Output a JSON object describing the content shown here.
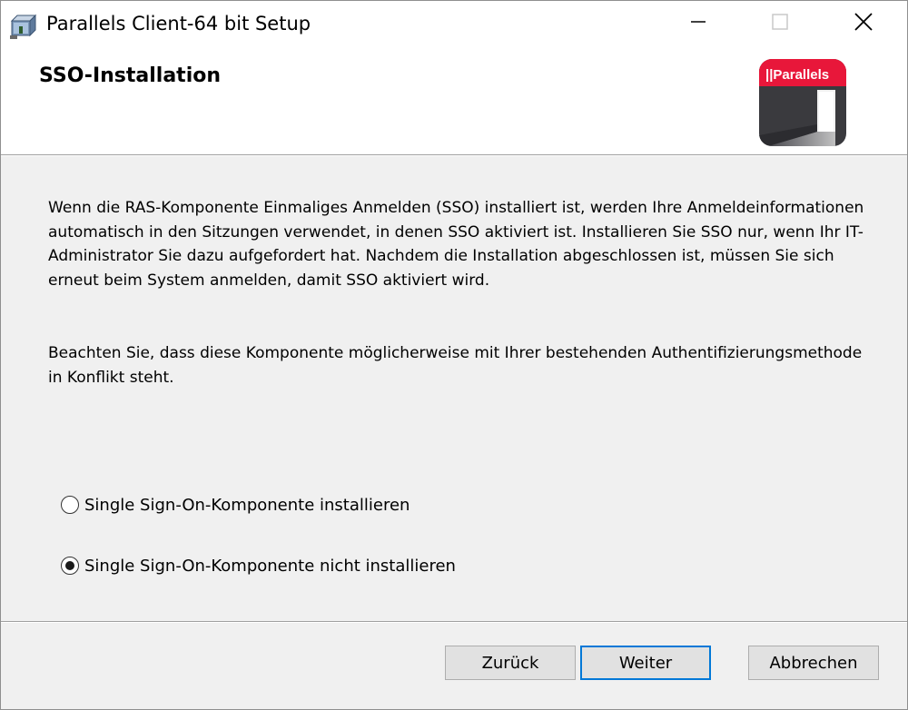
{
  "window": {
    "title": "Parallels Client-64 bit Setup",
    "icons": {
      "app": "installer-package-icon",
      "minimize": "minimize-icon",
      "maximize": "maximize-icon",
      "close": "close-icon"
    }
  },
  "header": {
    "title": "SSO-Installation",
    "logo_text": "||Parallels"
  },
  "content": {
    "paragraph1": "Wenn die RAS-Komponente Einmaliges Anmelden (SSO) installiert ist, werden Ihre Anmeldeinformationen automatisch in den Sitzungen verwendet, in denen SSO aktiviert ist. Installieren Sie SSO nur, wenn Ihr IT-Administrator Sie dazu aufgefordert hat. Nachdem die Installation abgeschlossen ist, müssen Sie sich erneut beim System anmelden, damit SSO aktiviert wird.",
    "paragraph2": "Beachten Sie, dass diese Komponente möglicherweise mit Ihrer bestehenden Authentifizierungsmethode in Konflikt steht.",
    "options": [
      {
        "label": "Single Sign-On-Komponente installieren",
        "selected": false
      },
      {
        "label": "Single Sign-On-Komponente nicht installieren",
        "selected": true
      }
    ]
  },
  "buttons": {
    "back": "Zurück",
    "next": "Weiter",
    "cancel": "Abbrechen"
  },
  "colors": {
    "brand_red": "#e8173a",
    "logo_dark": "#3a3a3e",
    "focus_blue": "#0078d7"
  }
}
